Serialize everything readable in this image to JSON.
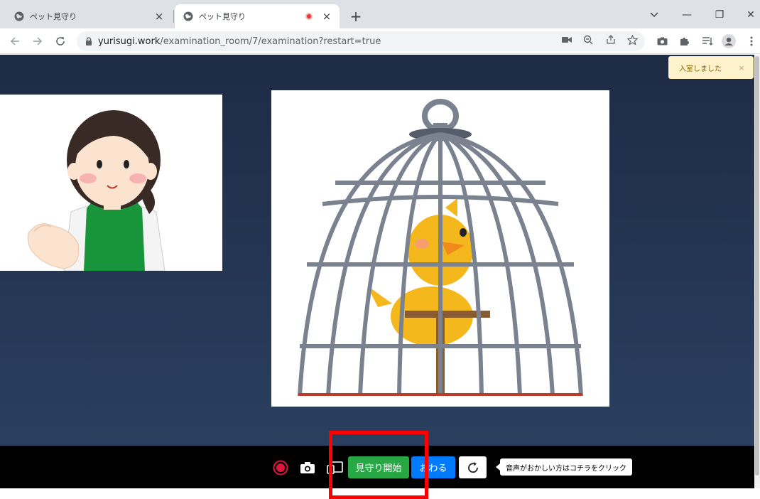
{
  "tabs": [
    {
      "title": "ペット見守り",
      "close": "×"
    },
    {
      "title": "ペット見守り",
      "close": "×"
    }
  ],
  "new_tab": "+",
  "window_controls": {
    "minimize": "—",
    "restore": "❐",
    "close": "✕"
  },
  "address_bar": {
    "host": "yurisugi.work",
    "path": "/examination_room/7/examination?restart=true"
  },
  "toast": {
    "message": "入室しました",
    "close": "×"
  },
  "controls": {
    "start_label": "見守り開始",
    "end_label": "おわる",
    "reload_symbol": "↻",
    "tooltip": "音声がおかしい方はコチラをクリック"
  },
  "colors": {
    "start": "#28a745",
    "end": "#007bff",
    "record": "#e0153c",
    "highlight": "#ff0000"
  }
}
